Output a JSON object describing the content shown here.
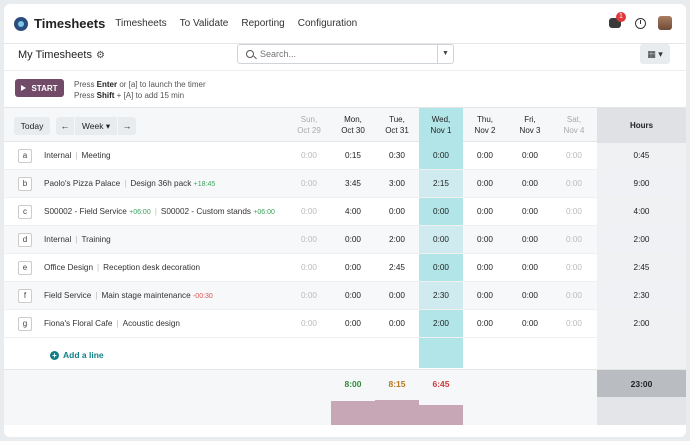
{
  "navbar": {
    "app_name": "Timesheets",
    "menu": [
      "Timesheets",
      "To Validate",
      "Reporting",
      "Configuration"
    ],
    "notification_count": "1"
  },
  "control_panel": {
    "title": "My Timesheets",
    "search_placeholder": "Search...",
    "view_switch_label": "▦ ▾"
  },
  "timer": {
    "start_label": "START",
    "help_line1_pre": "Press ",
    "help_line1_key": "Enter",
    "help_line1_post": " or [a] to launch the timer",
    "help_line2_pre": "Press ",
    "help_line2_key": "Shift",
    "help_line2_post": " + [A] to add 15 min"
  },
  "grid": {
    "today_label": "Today",
    "prev_label": "←",
    "next_label": "→",
    "range_label": "Week ▾",
    "hours_label": "Hours",
    "days": [
      {
        "line1": "Sun,",
        "line2": "Oct 29",
        "weekend": true
      },
      {
        "line1": "Mon,",
        "line2": "Oct 30",
        "weekend": false
      },
      {
        "line1": "Tue,",
        "line2": "Oct 31",
        "weekend": false
      },
      {
        "line1": "Wed,",
        "line2": "Nov 1",
        "weekend": false,
        "today": true
      },
      {
        "line1": "Thu,",
        "line2": "Nov 2",
        "weekend": false
      },
      {
        "line1": "Fri,",
        "line2": "Nov 3",
        "weekend": false
      },
      {
        "line1": "Sat,",
        "line2": "Nov 4",
        "weekend": true
      }
    ],
    "rows": [
      {
        "key": "a",
        "project": "Internal",
        "task": "Meeting",
        "values": [
          "0:00",
          "0:15",
          "0:30",
          "0:00",
          "0:00",
          "0:00",
          "0:00"
        ],
        "total": "0:45"
      },
      {
        "key": "b",
        "project": "Paolo's Pizza Palace",
        "task": "Design 36h pack",
        "task_delta": "+18:45",
        "values": [
          "0:00",
          "3:45",
          "3:00",
          "2:15",
          "0:00",
          "0:00",
          "0:00"
        ],
        "total": "9:00"
      },
      {
        "key": "c",
        "project": "S00002 - Field Service",
        "project_delta": "+06:00",
        "task": "S00002 - Custom stands",
        "task_delta": "+06:00",
        "values": [
          "0:00",
          "4:00",
          "0:00",
          "0:00",
          "0:00",
          "0:00",
          "0:00"
        ],
        "total": "4:00"
      },
      {
        "key": "d",
        "project": "Internal",
        "task": "Training",
        "values": [
          "0:00",
          "0:00",
          "2:00",
          "0:00",
          "0:00",
          "0:00",
          "0:00"
        ],
        "total": "2:00"
      },
      {
        "key": "e",
        "project": "Office Design",
        "task": "Reception desk decoration",
        "values": [
          "0:00",
          "0:00",
          "2:45",
          "0:00",
          "0:00",
          "0:00",
          "0:00"
        ],
        "total": "2:45"
      },
      {
        "key": "f",
        "project": "Field Service",
        "task": "Main stage maintenance",
        "task_delta": "-00:30",
        "task_delta_negative": true,
        "values": [
          "0:00",
          "0:00",
          "0:00",
          "2:30",
          "0:00",
          "0:00",
          "0:00"
        ],
        "total": "2:30"
      },
      {
        "key": "g",
        "project": "Fiona's Floral Cafe",
        "task": "Acoustic design",
        "values": [
          "0:00",
          "0:00",
          "0:00",
          "2:00",
          "0:00",
          "0:00",
          "0:00"
        ],
        "total": "2:00"
      }
    ],
    "add_line_label": "Add a line",
    "totals": [
      "",
      "8:00",
      "8:15",
      "6:45",
      "",
      "",
      ""
    ],
    "total_colors": [
      "#222222",
      "#2e8b3d",
      "#b8761f",
      "#d23a3a",
      "#222222",
      "#222222",
      "#222222"
    ],
    "grand_total": "23:00",
    "bar_fill": [
      0,
      1.0,
      1.03,
      0.84,
      0,
      0,
      0
    ]
  }
}
